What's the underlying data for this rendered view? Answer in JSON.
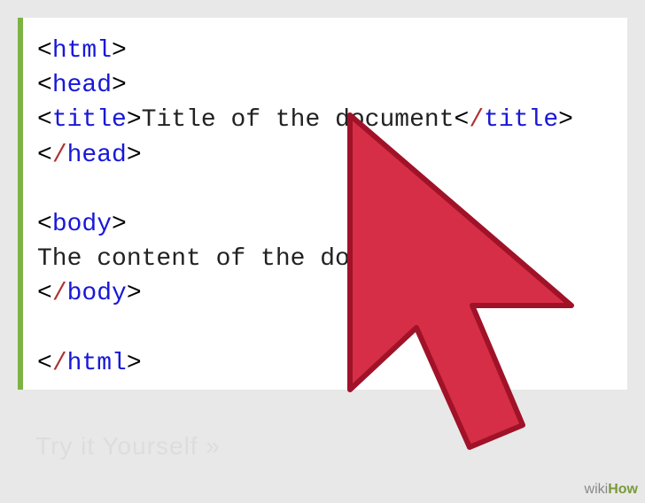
{
  "code": {
    "tags": {
      "html_open": "html",
      "head_open": "head",
      "title_open": "title",
      "title_close": "title",
      "head_close": "head",
      "body_open": "body",
      "body_close": "body",
      "html_close": "html"
    },
    "title_text": "Title of the document",
    "body_text": "The content of the document......"
  },
  "watermark": {
    "wiki": "wiki",
    "how": "How"
  },
  "faded": "Try it Yourself »"
}
